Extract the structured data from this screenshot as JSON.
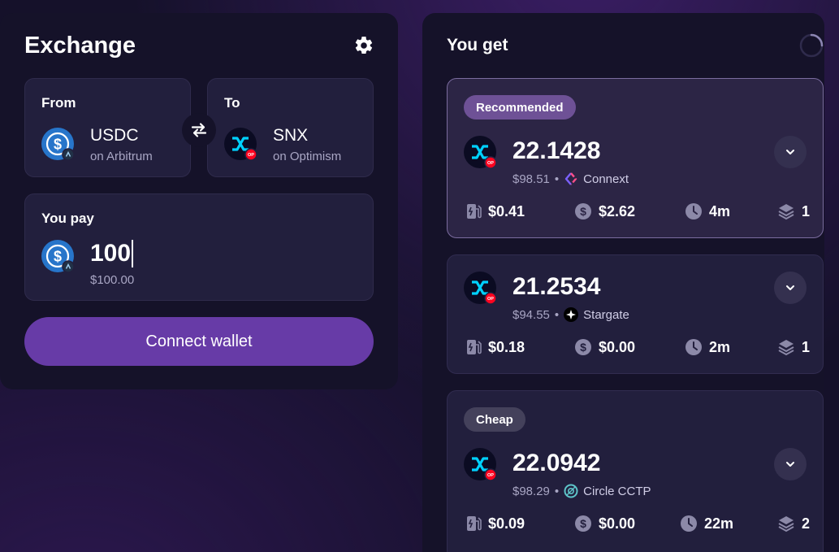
{
  "exchange": {
    "title": "Exchange",
    "from": {
      "label": "From",
      "token": "USDC",
      "chain": "on Arbitrum"
    },
    "to": {
      "label": "To",
      "token": "SNX",
      "chain": "on Optimism"
    },
    "pay": {
      "label": "You pay",
      "amount": "100",
      "usd": "$100.00"
    },
    "connect_label": "Connect wallet"
  },
  "you_get": {
    "title": "You get",
    "routes": [
      {
        "badge": "Recommended",
        "amount": "22.1428",
        "usd": "$98.51",
        "bridge": "Connext",
        "gas": "$0.41",
        "fee": "$2.62",
        "time": "4m",
        "steps": "1"
      },
      {
        "badge": "",
        "amount": "21.2534",
        "usd": "$94.55",
        "bridge": "Stargate",
        "gas": "$0.18",
        "fee": "$0.00",
        "time": "2m",
        "steps": "1"
      },
      {
        "badge": "Cheap",
        "amount": "22.0942",
        "usd": "$98.29",
        "bridge": "Circle CCTP",
        "gas": "$0.09",
        "fee": "$0.00",
        "time": "22m",
        "steps": "2"
      }
    ]
  },
  "chain_badge_op": "OP",
  "icons": {
    "settings": "gear-icon",
    "swap": "swap-arrows-icon",
    "loading": "loading-spinner-icon",
    "expand": "chevron-down-icon",
    "gas": "gas-pump-icon",
    "fee": "dollar-coin-icon",
    "time": "clock-icon",
    "steps": "layers-icon"
  },
  "colors": {
    "accent": "#673ba7",
    "badge_recommended": "#6e5196",
    "badge_cheap": "#44415b",
    "usdc": "#2775ca",
    "snx_cyan": "#00d1ff",
    "op_red": "#ff0420"
  }
}
